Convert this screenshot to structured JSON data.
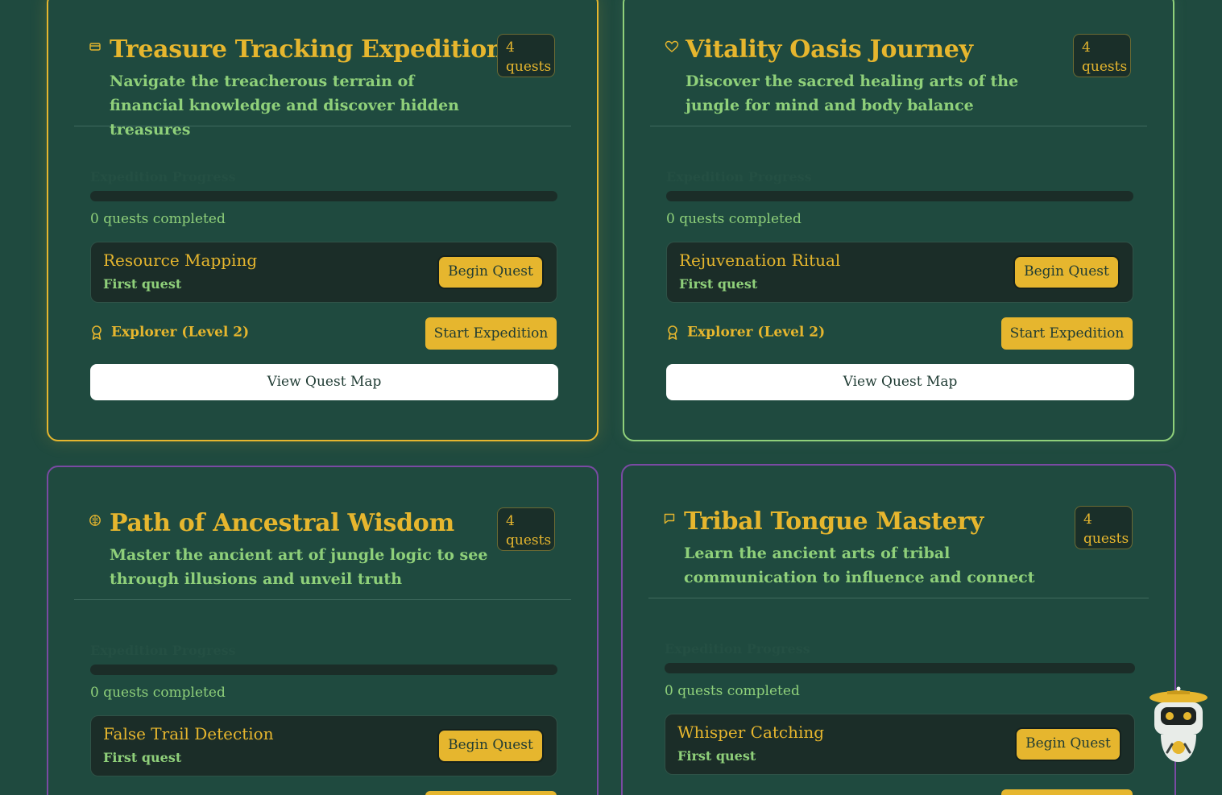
{
  "colors": {
    "background": "#1f4a3f",
    "accent_gold": "#e6b62e",
    "accent_green": "#8fd07a",
    "accent_purple": "#7a4aa3"
  },
  "cards": [
    {
      "icon": "wallet-icon",
      "title": "Treasure Tracking Expedition",
      "description": "Navigate the treacherous terrain of financial knowledge and discover hidden treasures",
      "quest_count_badge": "4 quests",
      "progress_label": "Expedition Progress",
      "progress": 0,
      "completed_text": "0 quests completed",
      "current_quest": {
        "name": "Resource Mapping",
        "subtitle": "First quest",
        "button": "Begin Quest"
      },
      "rank": "Explorer (Level 2)",
      "start_button": "Start Expedition",
      "map_button": "View Quest Map"
    },
    {
      "icon": "heart-icon",
      "title": "Vitality Oasis Journey",
      "description": "Discover the sacred healing arts of the jungle for mind and body balance",
      "quest_count_badge": "4 quests",
      "progress_label": "Expedition Progress",
      "progress": 0,
      "completed_text": "0 quests completed",
      "current_quest": {
        "name": "Rejuvenation Ritual",
        "subtitle": "First quest",
        "button": "Begin Quest"
      },
      "rank": "Explorer (Level 2)",
      "start_button": "Start Expedition",
      "map_button": "View Quest Map"
    },
    {
      "icon": "brain-icon",
      "title": "Path of Ancestral Wisdom",
      "description": "Master the ancient art of jungle logic to see through illusions and unveil truth",
      "quest_count_badge": "4 quests",
      "progress_label": "Expedition Progress",
      "progress": 0,
      "completed_text": "0 quests completed",
      "current_quest": {
        "name": "False Trail Detection",
        "subtitle": "First quest",
        "button": "Begin Quest"
      }
    },
    {
      "icon": "speech-bubble-icon",
      "title": "Tribal Tongue Mastery",
      "description": "Learn the ancient arts of tribal communication to influence and connect",
      "quest_count_badge": "4 quests",
      "progress_label": "Expedition Progress",
      "progress": 0,
      "completed_text": "0 quests completed",
      "current_quest": {
        "name": "Whisper Catching",
        "subtitle": "First quest",
        "button": "Begin Quest"
      }
    }
  ],
  "assistant": {
    "icon": "explorer-robot-icon"
  }
}
